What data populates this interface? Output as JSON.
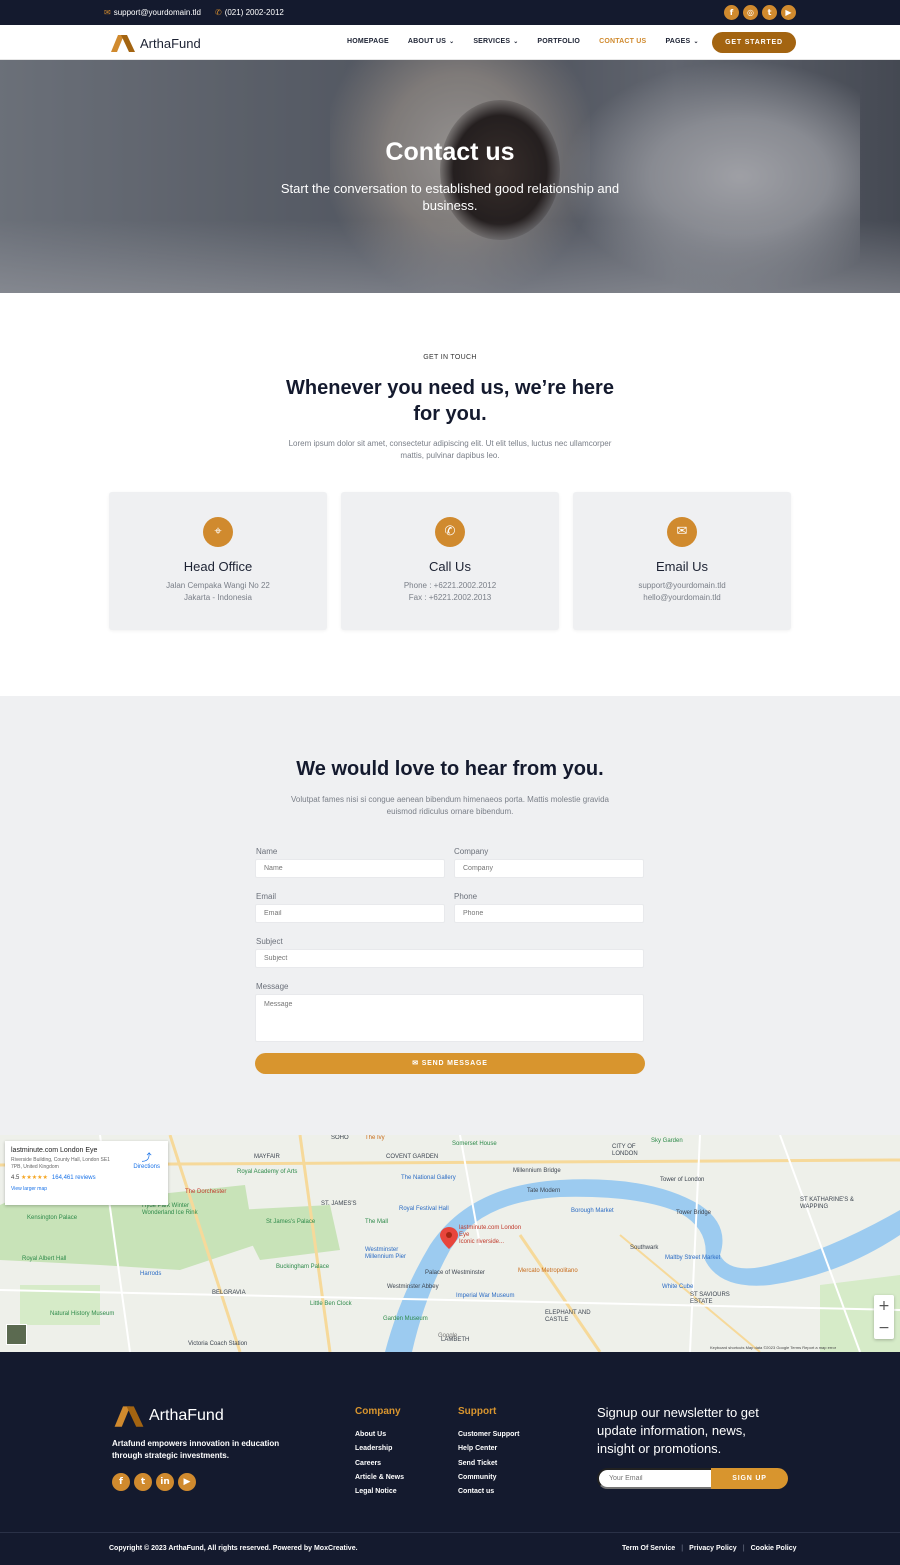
{
  "topbar": {
    "email": "support@yourdomain.tld",
    "phone": "(021) 2002-2012",
    "socials": [
      "facebook-icon",
      "instagram-icon",
      "twitter-icon",
      "youtube-icon"
    ]
  },
  "brand": {
    "name": "ArthaFund",
    "accent": "#d08a2e",
    "dark": "#141a2e"
  },
  "nav": {
    "items": [
      {
        "label": "HOMEPAGE",
        "caret": false,
        "active": false
      },
      {
        "label": "ABOUT US",
        "caret": true,
        "active": false
      },
      {
        "label": "SERVICES",
        "caret": true,
        "active": false
      },
      {
        "label": "PORTFOLIO",
        "caret": false,
        "active": false
      },
      {
        "label": "CONTACT US",
        "caret": false,
        "active": true
      },
      {
        "label": "PAGES",
        "caret": true,
        "active": false
      }
    ],
    "cta": "GET STARTED"
  },
  "hero": {
    "title": "Contact us",
    "subtitle": "Start the conversation to established good relationship and business."
  },
  "touch": {
    "eyebrow": "GET IN TOUCH",
    "heading": "Whenever you need us, we’re here for you.",
    "lead": "Lorem ipsum dolor sit amet, consectetur adipiscing elit. Ut elit tellus, luctus nec ullamcorper mattis, pulvinar dapibus leo."
  },
  "cards": [
    {
      "icon": "location-pin-icon",
      "title": "Head Office",
      "line1": "Jalan Cempaka Wangi No 22",
      "line2": "Jakarta - Indonesia"
    },
    {
      "icon": "phone-icon",
      "title": "Call Us",
      "line1": "Phone : +6221.2002.2012",
      "line2": "Fax : +6221.2002.2013"
    },
    {
      "icon": "envelope-icon",
      "title": "Email Us",
      "line1": "support@yourdomain.tld",
      "line2": "hello@yourdomain.tld"
    }
  ],
  "form": {
    "heading": "We would love to hear from you.",
    "lead": "Volutpat fames nisi si congue aenean bibendum himenaeos porta. Mattis molestie gravida euismod ridiculus ornare bibendum.",
    "fields": {
      "name": {
        "label": "Name",
        "placeholder": "Name"
      },
      "company": {
        "label": "Company",
        "placeholder": "Company"
      },
      "email": {
        "label": "Email",
        "placeholder": "Email"
      },
      "phone": {
        "label": "Phone",
        "placeholder": "Phone"
      },
      "subject": {
        "label": "Subject",
        "placeholder": "Subject"
      },
      "message": {
        "label": "Message",
        "placeholder": "Message"
      }
    },
    "submit": "SEND MESSAGE"
  },
  "map": {
    "place": "lastminute.com London Eye",
    "address": "Riverside Building, County Hall, London SE1 7PB, United Kingdom",
    "rating": "4.5",
    "stars": "★★★★★",
    "reviews": "164,461 reviews",
    "directions": "Directions",
    "larger": "View larger map",
    "pin_label": "lastminute.com London Eye",
    "pin_sub": "Iconic riverside...",
    "labels": {
      "soho": "SOHO",
      "mayfair": "MAYFAIR",
      "covent": "COVENT GARDEN",
      "city": "CITY OF LONDON",
      "stjames": "ST. JAMES'S",
      "belgravia": "BELGRAVIA",
      "katharine": "ST KATHARINE'S & WAPPING",
      "southwark": "SOUTHWARK",
      "saviours": "ST SAVIOURS ESTATE",
      "elephant": "ELEPHANT AND CASTLE",
      "lambeth": "LAMBETH",
      "ra": "Royal Academy of Arts",
      "gallery": "The National Gallery",
      "millennium": "Millennium Bridge",
      "tate": "Tate Modern",
      "tower": "Tower of London",
      "borough": "Borough Market",
      "towerbridge": "Tower Bridge",
      "dorchester": "The Dorchester",
      "hydepark": "Hyde Park Winter Wonderland Ice Rink",
      "kensington": "Kensington Palace",
      "albert": "Royal Albert Hall",
      "harrods": "Harrods",
      "nhm": "Natural History Museum",
      "buckingham": "Buckingham Palace",
      "littleben": "Little Ben Clock",
      "victoria": "Victoria Coach Station",
      "westminster": "Westminster Abbey",
      "palace": "Palace of Westminster",
      "iwm": "Imperial War Museum",
      "mercato": "Mercato Metropolitano",
      "maltby": "Maltby Street Market",
      "whitecube": "White Cube",
      "garden": "Garden Museum",
      "pier": "Westminster Millennium Pier",
      "stjpalace": "St James's Palace",
      "mall": "The Mall",
      "festival": "Royal Festival Hall",
      "ivy": "The Ivy",
      "somerset": "Somerset House",
      "skygarden": "Sky Garden",
      "southwarkpark": "Southwark"
    },
    "footer_text": "Keyboard shortcuts   Map data ©2023 Google   Terms   Report a map error",
    "google": "Google"
  },
  "footer": {
    "description": "Artafund empowers innovation in education through strategic investments.",
    "socials": [
      "facebook-icon",
      "twitter-icon",
      "linkedin-icon",
      "youtube-icon"
    ],
    "company_heading": "Company",
    "company_links": [
      "About Us",
      "Leadership",
      "Careers",
      "Article & News",
      "Legal Notice"
    ],
    "support_heading": "Support",
    "support_links": [
      "Customer Support",
      "Help Center",
      "Send Ticket",
      "Community",
      "Contact us"
    ],
    "newsletter_heading": "Signup our newsletter to get update information, news, insight or promotions.",
    "newsletter_placeholder": "Your Email",
    "newsletter_button": "SIGN UP",
    "copyright": "Copyright © 2023 ArthaFund, All rights reserved. Powered by MoxCreative.",
    "legal": [
      "Term Of Service",
      "Privacy Policy",
      "Cookie Policy"
    ]
  }
}
